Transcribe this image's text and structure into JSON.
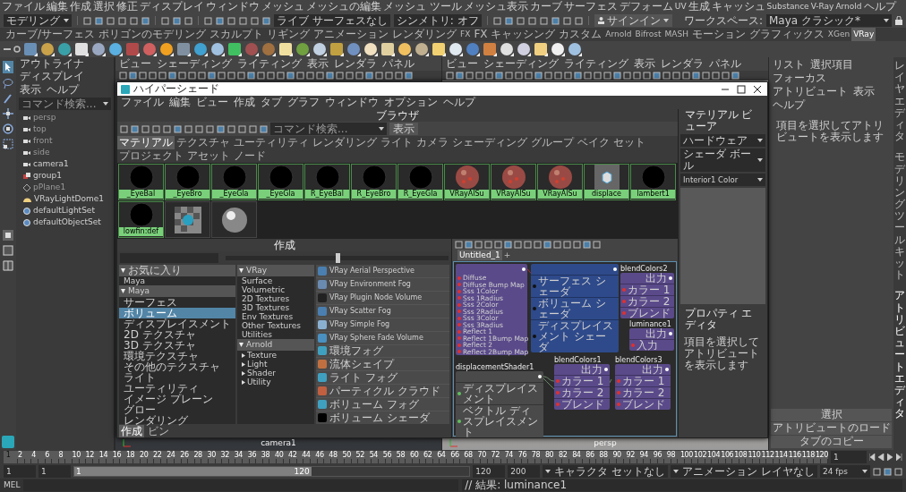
{
  "menu_bar": [
    "ファイル",
    "編集",
    "作成",
    "選択",
    "修正",
    "ディスプレイ",
    "ウィンドウ",
    "メッシュ",
    "メッシュの編集",
    "メッシュ ツール",
    "メッシュ表示",
    "カーブ",
    "サーフェス",
    "デフォーム",
    "UV",
    "生成",
    "キャッシュ",
    "Substance",
    "V-Ray",
    "Arnold",
    "ヘルプ"
  ],
  "status_line": {
    "mode": "モデリング",
    "live_surface": "ライブ サーフェスなし",
    "symmetry": "シンメトリ: オフ",
    "sign_in": "サインイン",
    "workspace_label": "ワークスペース:",
    "workspace": "Maya クラシック*"
  },
  "shelf_tabs": [
    {
      "label": "カーブ/サーフェス",
      "selected": false
    },
    {
      "label": "ポリゴンのモデリング",
      "selected": false
    },
    {
      "label": "スカルプト",
      "selected": false
    },
    {
      "label": "リギング",
      "selected": false
    },
    {
      "label": "アニメーション",
      "selected": false
    },
    {
      "label": "レンダリング",
      "selected": false
    },
    {
      "label": "FX",
      "selected": false
    },
    {
      "label": "FX キャッシング",
      "selected": false
    },
    {
      "label": "カスタム",
      "selected": false
    },
    {
      "label": "Arnold",
      "selected": false
    },
    {
      "label": "Bifrost",
      "selected": false
    },
    {
      "label": "MASH",
      "selected": false
    },
    {
      "label": "モーション グラフィックス",
      "selected": false
    },
    {
      "label": "XGen",
      "selected": false
    },
    {
      "label": "VRay",
      "selected": true
    }
  ],
  "outliner": {
    "title": "アウトライナ",
    "menu": [
      "ディスプレイ",
      "表示",
      "ヘルプ"
    ],
    "placeholder": "コマンド検索...",
    "items": [
      {
        "label": "persp",
        "kind": "camera",
        "dimmed": true
      },
      {
        "label": "top",
        "kind": "camera",
        "dimmed": true
      },
      {
        "label": "front",
        "kind": "camera",
        "dimmed": true
      },
      {
        "label": "side",
        "kind": "camera",
        "dimmed": true
      },
      {
        "label": "camera1",
        "kind": "camera",
        "dimmed": false
      },
      {
        "label": "group1",
        "kind": "group",
        "dimmed": false
      },
      {
        "label": "pPlane1",
        "kind": "mesh",
        "dimmed": true
      },
      {
        "label": "VRayLightDome1",
        "kind": "light",
        "dimmed": false
      },
      {
        "label": "defaultLightSet",
        "kind": "set",
        "dimmed": false
      },
      {
        "label": "defaultObjectSet",
        "kind": "set",
        "dimmed": false
      }
    ]
  },
  "viewports": [
    {
      "menu": [
        "ビュー",
        "シェーディング",
        "ライティング",
        "表示",
        "レンダラ",
        "パネル"
      ],
      "camera": "camera1"
    },
    {
      "menu": [
        "ビュー",
        "シェーディング",
        "ライティング",
        "表示",
        "レンダラ",
        "パネル"
      ],
      "camera": "persp"
    }
  ],
  "hypershade": {
    "title": "ハイパーシェード",
    "menu": [
      "ファイル",
      "編集",
      "ビュー",
      "作成",
      "タブ",
      "グラフ",
      "ウィンドウ",
      "オプション",
      "ヘルプ"
    ],
    "browser": {
      "title": "ブラウザ",
      "placeholder": "コマンド検索...",
      "show_button": "表示",
      "tabs": [
        {
          "label": "マテリアル",
          "selected": true
        },
        {
          "label": "テクスチャ",
          "selected": false
        },
        {
          "label": "ユーティリティ",
          "selected": false
        },
        {
          "label": "レンダリング",
          "selected": false
        },
        {
          "label": "ライト",
          "selected": false
        },
        {
          "label": "カメラ",
          "selected": false
        },
        {
          "label": "シェーディング グループ",
          "selected": false
        },
        {
          "label": "ベイク セット",
          "selected": false
        },
        {
          "label": "プロジェクト",
          "selected": false
        },
        {
          "label": "アセット ノード",
          "selected": false
        }
      ],
      "swatches": [
        {
          "label": "_EyeBal",
          "kind": "black"
        },
        {
          "label": "_EyeBro",
          "kind": "black"
        },
        {
          "label": "_EyeGla",
          "kind": "black"
        },
        {
          "label": "_EyeGla",
          "kind": "black"
        },
        {
          "label": "R_EyeBal",
          "kind": "black"
        },
        {
          "label": "R_EyeBro",
          "kind": "black"
        },
        {
          "label": "R_EyeGla",
          "kind": "black"
        },
        {
          "label": "VRayAlSu",
          "kind": "skin"
        },
        {
          "label": "VRayAlSu",
          "kind": "skin"
        },
        {
          "label": "VRayAlSu",
          "kind": "skin"
        },
        {
          "label": "displace",
          "kind": "displacement"
        },
        {
          "label": "lambert1",
          "kind": "black"
        },
        {
          "label": "lowfin:def",
          "kind": "black"
        },
        {
          "kind": "checker"
        },
        {
          "kind": "chrome"
        }
      ]
    },
    "create": {
      "title": "作成",
      "size_slider": {
        "level": 0.5
      },
      "categories": [
        {
          "label": "お気に入り",
          "children": [
            {
              "label": "Maya",
              "selected": false
            }
          ]
        },
        {
          "label": "Maya",
          "children": [
            {
              "label": "サーフェス",
              "selected": false
            },
            {
              "label": "ボリューム",
              "selected": true
            },
            {
              "label": "ディスプレイスメント",
              "selected": false
            },
            {
              "label": "2D テクスチャ",
              "selected": false
            },
            {
              "label": "3D テクスチャ",
              "selected": false
            },
            {
              "label": "環境テクスチャ",
              "selected": false
            },
            {
              "label": "その他のテクスチャ",
              "selected": false
            },
            {
              "label": "ライト",
              "selected": false
            },
            {
              "label": "ユーティリティ",
              "selected": false
            },
            {
              "label": "イメージ プレーン",
              "selected": false
            },
            {
              "label": "グロー",
              "selected": false
            },
            {
              "label": "レンダリング",
              "selected": false
            }
          ]
        },
        {
          "label": "VRay",
          "children": [
            {
              "label": "Surface",
              "selected": false
            },
            {
              "label": "Volumetric",
              "selected": false
            },
            {
              "label": "2D Textures",
              "selected": false
            },
            {
              "label": "3D Textures",
              "selected": false
            },
            {
              "label": "Env Textures",
              "selected": false
            },
            {
              "label": "Other Textures",
              "selected": false
            },
            {
              "label": "Utilities",
              "selected": false
            }
          ]
        },
        {
          "label": "Arnold",
          "children": [
            {
              "label": "Texture",
              "selected": false,
              "expanded": false
            },
            {
              "label": "Light",
              "selected": false,
              "expanded": false
            },
            {
              "label": "Shader",
              "selected": false,
              "expanded": false
            },
            {
              "label": "Utility",
              "selected": false,
              "expanded": false
            }
          ]
        }
      ],
      "node_types": [
        "VRay Aerial Perspective",
        "VRay Environment Fog",
        "VRay Plugin Node Volume",
        "VRay Scatter Fog",
        "VRay Simple Fog",
        "VRay Sphere Fade Volume",
        "環境フォグ",
        "流体シェイプ",
        "ライト フォグ",
        "パーティクル クラウド",
        "ボリューム フォグ",
        "ボリューム シェーダ"
      ],
      "bottom_tabs": [
        {
          "label": "作成",
          "selected": true
        },
        {
          "label": "ビン",
          "selected": false
        }
      ]
    },
    "node_editor": {
      "tabs": [
        {
          "label": "Untitled_1",
          "selected": true
        },
        {
          "label": "+",
          "selected": false
        }
      ],
      "nodes": [
        {
          "kind": "shader",
          "ports": [
            "Diffuse",
            "Diffuse Bump Map",
            "Sss 1Color",
            "Sss 1Radius",
            "Sss 2Color",
            "Sss 2Radius",
            "Sss 3Color",
            "Sss 3Radius",
            "Reflect 1",
            "Reflect 1Bump Map",
            "Reflect 2",
            "Reflect 2Bump Map"
          ]
        },
        {
          "kind": "shading_group",
          "ports": [
            "サーフェス シェーダ",
            "ボリューム シェーダ",
            "ディスプレイスメント シェーダ"
          ]
        },
        {
          "kind": "blend",
          "title": "luminance1",
          "output": "出力",
          "ports": [
            "入力"
          ]
        },
        {
          "kind": "utility",
          "title": "displacementShader1",
          "ports": [
            "ディスプレイスメント",
            "ベクトル ディスプレイスメント"
          ]
        },
        {
          "kind": "blend",
          "title": "blendColors1",
          "output": "出力",
          "ports": [
            "カラー 1",
            "カラー 2",
            "ブレンド"
          ]
        },
        {
          "kind": "blend",
          "title": "blendColors2",
          "output": "出力",
          "ports": [
            "カラー 1",
            "カラー 2",
            "ブレンド"
          ]
        },
        {
          "kind": "blend",
          "title": "blendColors3",
          "output": "出力",
          "ports": [
            "カラー 1",
            "カラー 2",
            "ブレンド"
          ]
        }
      ]
    },
    "material_viewer": {
      "title": "マテリアル ビューア",
      "renderer": "ハードウェア",
      "geometry": "シェーダ ボール",
      "material": "Interior1 Color"
    },
    "property_editor": {
      "title": "プロパティ エディタ",
      "message": "項目を選択してアトリビュートを表示します"
    }
  },
  "attribute_editor": {
    "menu": [
      "リスト",
      "選択項目",
      "フォーカス",
      "アトリビュート",
      "表示",
      "ヘルプ"
    ],
    "message": "項目を選択してアトリビュートを表示します",
    "bottom_buttons": [
      "選択",
      "アトリビュートのロード",
      "タブのコピー"
    ]
  },
  "side_tabs": [
    "レイヤエディタ",
    "モデリングツールキット",
    "アトリビュートエディタ"
  ],
  "timeline": {
    "current_frame": "1",
    "level": 0,
    "ticks": [
      "2",
      "4",
      "6",
      "8",
      "10",
      "12",
      "14",
      "16",
      "18",
      "20",
      "22",
      "24",
      "26",
      "28",
      "30",
      "32",
      "34",
      "36",
      "38",
      "40",
      "42",
      "44",
      "46",
      "48",
      "50",
      "52",
      "54",
      "56",
      "58",
      "60",
      "62",
      "64",
      "66",
      "68",
      "70",
      "72",
      "74",
      "76",
      "78",
      "80",
      "82",
      "84",
      "86",
      "88",
      "90",
      "92",
      "94",
      "96",
      "98",
      "100",
      "102",
      "104",
      "106",
      "108",
      "110",
      "112",
      "114",
      "116",
      "118",
      "120"
    ],
    "time_field": "1"
  },
  "range": {
    "start": "1",
    "playback_start": "1",
    "slider_start": "1",
    "slider_end": "120",
    "level": 0.6,
    "playback_end": "120",
    "end": "200",
    "character_set": "キャラクタ セットなし",
    "anim_layer": "アニメーション レイヤなし",
    "fps": "24 fps"
  },
  "command_line": {
    "language": "MEL",
    "result": "// 結果: luminance1"
  }
}
